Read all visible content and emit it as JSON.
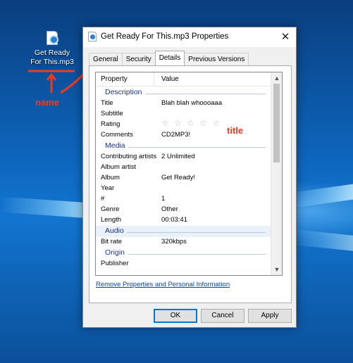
{
  "desktop": {
    "file_icon": {
      "line1": "Get Ready",
      "line2": "For This.mp3"
    },
    "annotations": {
      "name_label": "name",
      "title_label": "title",
      "color": "#f03a1e"
    }
  },
  "dialog": {
    "title": "Get Ready For This.mp3 Properties",
    "close_glyph": "✕",
    "tabs": [
      {
        "label": "General",
        "active": false
      },
      {
        "label": "Security",
        "active": false
      },
      {
        "label": "Details",
        "active": true
      },
      {
        "label": "Previous Versions",
        "active": false
      }
    ],
    "list": {
      "header_property": "Property",
      "header_value": "Value",
      "sections": {
        "description": {
          "label": "Description",
          "rows": [
            {
              "property": "Title",
              "value": "Blah blah whoooaaa"
            },
            {
              "property": "Subtitle",
              "value": ""
            },
            {
              "property": "Rating",
              "value": "☆ ☆ ☆ ☆ ☆"
            },
            {
              "property": "Comments",
              "value": "CD2MP3!"
            }
          ]
        },
        "media": {
          "label": "Media",
          "rows": [
            {
              "property": "Contributing artists",
              "value": "2 Unlimited"
            },
            {
              "property": "Album artist",
              "value": ""
            },
            {
              "property": "Album",
              "value": "Get Ready!"
            },
            {
              "property": "Year",
              "value": ""
            },
            {
              "property": "#",
              "value": "1"
            },
            {
              "property": "Genre",
              "value": "Other"
            },
            {
              "property": "Length",
              "value": "00:03:41"
            }
          ]
        },
        "audio": {
          "label": "Audio",
          "rows": [
            {
              "property": "Bit rate",
              "value": "320kbps"
            }
          ]
        },
        "origin": {
          "label": "Origin",
          "rows": [
            {
              "property": "Publisher",
              "value": ""
            }
          ]
        }
      }
    },
    "remove_link": "Remove Properties and Personal Information",
    "buttons": {
      "ok": "OK",
      "cancel": "Cancel",
      "apply": "Apply"
    },
    "accent_color": "#0078d7"
  }
}
